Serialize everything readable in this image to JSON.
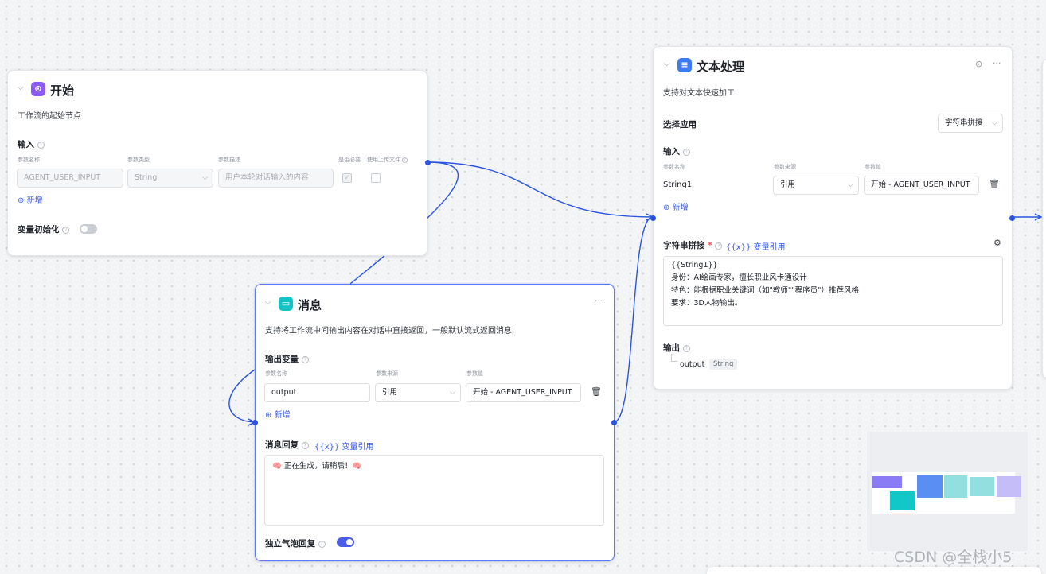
{
  "start_node": {
    "title": "开始",
    "description": "工作流的起始节点",
    "input_section": "输入",
    "columns": {
      "name": "参数名称",
      "type": "参数类型",
      "desc": "参数描述",
      "required": "是否必要",
      "upload": "使用上传文件"
    },
    "param_name": "AGENT_USER_INPUT",
    "param_type": "String",
    "param_desc_placeholder": "用户本轮对话输入的内容",
    "add_label": "新增",
    "var_init_label": "变量初始化"
  },
  "message_node": {
    "title": "消息",
    "description": "支持将工作流中间输出内容在对话中直接返回，一般默认流式返回消息",
    "output_section": "输出变量",
    "columns": {
      "name": "参数名称",
      "source": "参数来源",
      "value": "参数值"
    },
    "param_name": "output",
    "param_source": "引用",
    "param_value": "开始 - AGENT_USER_INPUT",
    "add_label": "新增",
    "reply_label": "消息回复",
    "var_ref_label": "{{x}} 变量引用",
    "reply_text": "🧠 正在生成，请稍后！🧠",
    "bubble_label": "独立气泡回复"
  },
  "text_node": {
    "title": "文本处理",
    "description": "支持对文本快速加工",
    "select_app_label": "选择应用",
    "select_app_value": "字符串拼接",
    "input_section": "输入",
    "columns": {
      "name": "参数名称",
      "source": "参数来源",
      "value": "参数值"
    },
    "param_name": "String1",
    "param_source": "引用",
    "param_value": "开始 - AGENT_USER_INPUT",
    "add_label": "新增",
    "concat_label": "字符串拼接",
    "required_mark": "*",
    "var_ref_label": "{{x}} 变量引用",
    "concat_text": "{{String1}}\n身份：AI绘画专家，擅长职业风卡通设计\n特色：能根据职业关键词（如\"教师\"\"程序员\"）推荐风格\n要求：3D人物输出。",
    "output_section": "输出",
    "output_name": "output",
    "output_type": "String"
  },
  "watermark": "CSDN @全栈小5",
  "icons": {
    "collapse": "chevron-down-icon",
    "start": "start-node-icon",
    "message": "message-node-icon",
    "text": "text-node-icon",
    "run": "play-circle-icon",
    "more": "more-icon",
    "delete": "trash-icon",
    "settings": "gear-icon",
    "add": "plus-circle-icon"
  },
  "colors": {
    "accent": "#3a5ee8",
    "connector": "#2b54e0",
    "start_icon": "#8b5cf6",
    "message_icon": "#14c2c2",
    "text_icon": "#3d7bf5",
    "minimap": [
      "#8b7cf6",
      "#5b8ef2",
      "#91dfdf",
      "#c5bdf7",
      "#12c7c7"
    ]
  }
}
